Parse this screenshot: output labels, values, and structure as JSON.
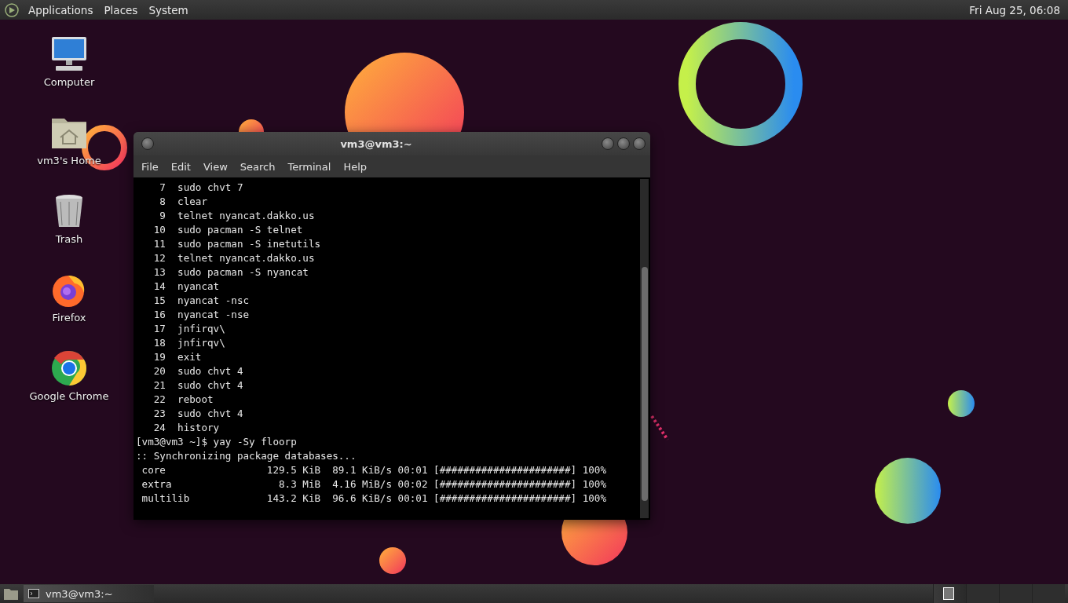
{
  "top_panel": {
    "menus": [
      "Applications",
      "Places",
      "System"
    ],
    "clock": "Fri Aug 25, 06:08"
  },
  "desktop_icons": [
    {
      "kind": "computer",
      "label": "Computer"
    },
    {
      "kind": "home",
      "label": "vm3's Home"
    },
    {
      "kind": "trash",
      "label": "Trash"
    },
    {
      "kind": "firefox",
      "label": "Firefox"
    },
    {
      "kind": "chrome",
      "label": "Google Chrome"
    }
  ],
  "terminal": {
    "title": "vm3@vm3:~",
    "menus": [
      "File",
      "Edit",
      "View",
      "Search",
      "Terminal",
      "Help"
    ],
    "lines": [
      "    7  sudo chvt 7",
      "    8  clear",
      "    9  telnet nyancat.dakko.us",
      "   10  sudo pacman -S telnet",
      "   11  sudo pacman -S inetutils",
      "   12  telnet nyancat.dakko.us",
      "   13  sudo pacman -S nyancat",
      "   14  nyancat",
      "   15  nyancat -nsc",
      "   16  nyancat -nse",
      "   17  jnfirqv\\",
      "   18  jnfirqv\\",
      "   19  exit",
      "   20  sudo chvt 4",
      "   21  sudo chvt 4",
      "   22  reboot",
      "   23  sudo chvt 4",
      "   24  history",
      "[vm3@vm3 ~]$ yay -Sy floorp",
      ":: Synchronizing package databases...",
      " core                 129.5 KiB  89.1 KiB/s 00:01 [######################] 100%",
      " extra                  8.3 MiB  4.16 MiB/s 00:02 [######################] 100%",
      " multilib             143.2 KiB  96.6 KiB/s 00:01 [######################] 100%"
    ]
  },
  "taskbar": {
    "tasks": [
      {
        "label": "vm3@vm3:~",
        "selected": true
      }
    ],
    "workspaces": [
      {
        "selected": true
      },
      {
        "selected": false
      },
      {
        "selected": false
      },
      {
        "selected": false
      }
    ]
  }
}
